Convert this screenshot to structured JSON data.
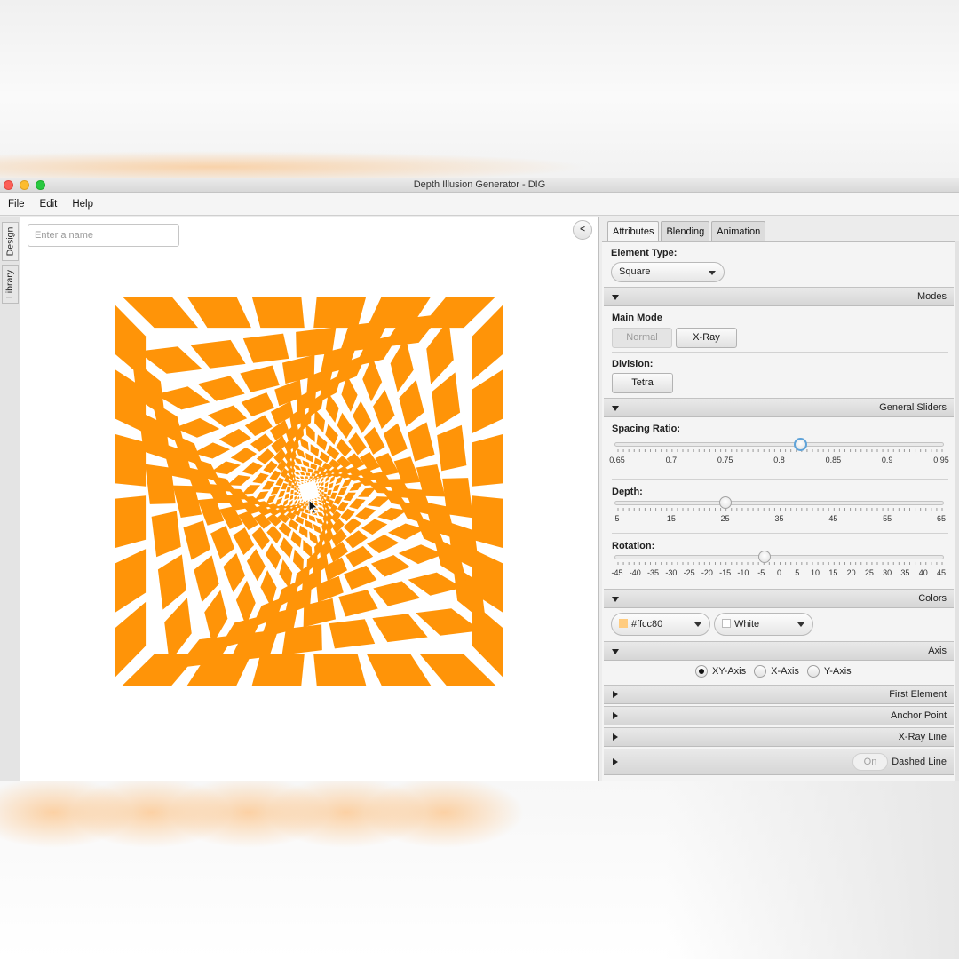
{
  "window": {
    "title": "Depth Illusion Generator - DIG"
  },
  "menu": [
    "File",
    "Edit",
    "Help"
  ],
  "side_tabs": [
    "Design",
    "Library"
  ],
  "name_input": {
    "placeholder": "Enter a name",
    "value": ""
  },
  "collapse_button": "<",
  "panel": {
    "tabs": [
      "Attributes",
      "Blending",
      "Animation"
    ],
    "element_type": {
      "label": "Element Type:",
      "value": "Square"
    },
    "modes": {
      "title": "Modes",
      "main_mode_label": "Main Mode",
      "main_mode_buttons": [
        "Normal",
        "X-Ray"
      ],
      "division_label": "Division:",
      "division_button": "Tetra"
    },
    "general_sliders": {
      "title": "General Sliders",
      "spacing": {
        "label": "Spacing Ratio:",
        "ticks": [
          "0.65",
          "0.7",
          "0.75",
          "0.8",
          "0.85",
          "0.9",
          "0.95"
        ],
        "value": 0.82
      },
      "depth": {
        "label": "Depth:",
        "ticks": [
          "5",
          "15",
          "25",
          "35",
          "45",
          "55",
          "65"
        ],
        "value": 25
      },
      "rotation": {
        "label": "Rotation:",
        "ticks": [
          "-45",
          "-40",
          "-35",
          "-30",
          "-25",
          "-20",
          "-15",
          "-10",
          "-5",
          "0",
          "5",
          "10",
          "15",
          "20",
          "25",
          "30",
          "35",
          "40",
          "45"
        ],
        "value": -4
      }
    },
    "colors": {
      "title": "Colors",
      "primary": {
        "value": "#ffcc80",
        "swatch": "#ffcc80"
      },
      "secondary": {
        "value": "White",
        "swatch": "#ffffff"
      }
    },
    "axis": {
      "title": "Axis",
      "options": [
        "XY-Axis",
        "X-Axis",
        "Y-Axis"
      ],
      "selected": "XY-Axis"
    },
    "collapsed_sections": [
      "First Element",
      "Anchor Point",
      "X-Ray Line"
    ],
    "dashed_line": {
      "title": "Dashed Line",
      "toggle": "On"
    }
  },
  "illusion_color": "#ff9408"
}
